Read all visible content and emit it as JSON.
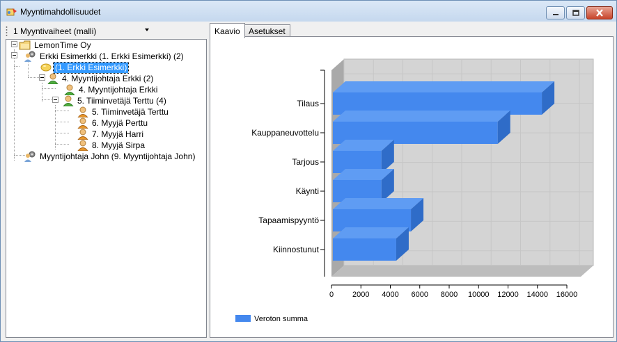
{
  "window": {
    "title": "Myyntimahdollisuudet",
    "icon": "opportunity-app-icon"
  },
  "toolbar": {
    "selected_view": "1 Myyntivaiheet (malli)"
  },
  "tree": {
    "nodes": [
      {
        "label": "LemonTime Oy",
        "icon": "folder-company-icon",
        "depth": 0
      },
      {
        "label": "Erkki Esimerkki (1. Erkki Esimerkki) (2)",
        "icon": "group-gear-icon",
        "depth": 1
      },
      {
        "label": "(1. Erkki Esimerkki)",
        "icon": "lemon-icon",
        "depth": 2,
        "selected": true
      },
      {
        "label": "4. Myyntijohtaja Erkki (2)",
        "icon": "person-icon",
        "depth": 2
      },
      {
        "label": "4. Myyntijohtaja Erkki",
        "icon": "person-icon",
        "depth": 3
      },
      {
        "label": "5. Tiiminvetäjä Terttu (4)",
        "icon": "person-icon",
        "depth": 3
      },
      {
        "label": "5. Tiiminvetäjä Terttu",
        "icon": "person-icon",
        "depth": 4
      },
      {
        "label": "6. Myyjä Perttu",
        "icon": "person-icon",
        "depth": 4
      },
      {
        "label": "7. Myyjä Harri",
        "icon": "person-icon",
        "depth": 4
      },
      {
        "label": "8. Myyjä Sirpa",
        "icon": "person-icon",
        "depth": 4
      },
      {
        "label": "Myyntijohtaja John (9. Myyntijohtaja John)",
        "icon": "group-gear-icon",
        "depth": 1
      }
    ]
  },
  "tabs": [
    {
      "label": "Kaavio",
      "active": true
    },
    {
      "label": "Asetukset",
      "active": false
    }
  ],
  "chart_data": {
    "type": "bar",
    "orientation": "horizontal",
    "categories": [
      "Tilaus",
      "Kauppaneuvottelu",
      "Tarjous",
      "Käynti",
      "Tapaamispyyntö",
      "Kiinnostunut"
    ],
    "series": [
      {
        "name": "Veroton summa",
        "values": [
          14300,
          11300,
          3400,
          3400,
          5400,
          4400
        ],
        "color": "#4488ee"
      }
    ],
    "xlim": [
      0,
      16000
    ],
    "xticks": [
      "0",
      "2000",
      "4000",
      "6000",
      "8000",
      "10000",
      "12000",
      "14000",
      "16000"
    ],
    "grid": true,
    "style": "3d",
    "legend": "bottom-left"
  }
}
